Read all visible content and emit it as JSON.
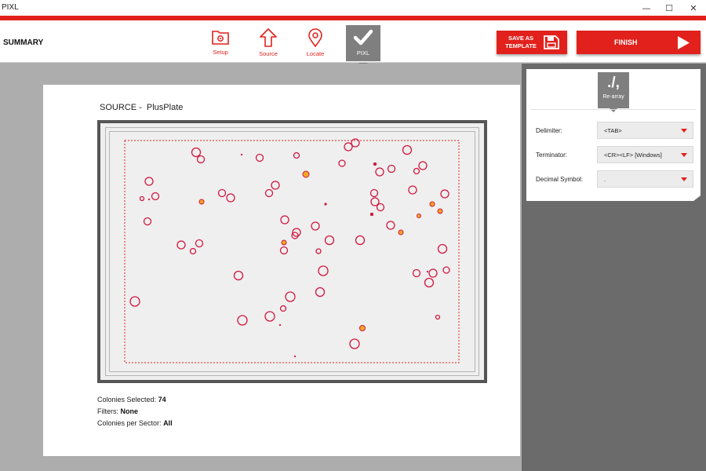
{
  "app": {
    "title": "PIXL",
    "window_controls": {
      "minimize": "—",
      "maximize": "☐",
      "close": "✕"
    }
  },
  "header": {
    "summary_label": "SUMMARY",
    "steps": [
      {
        "label": "Setup",
        "icon": "gear-folder-icon"
      },
      {
        "label": "Source",
        "icon": "arrow-up-icon"
      },
      {
        "label": "Locate",
        "icon": "location-pin-icon"
      },
      {
        "label": "PIXL",
        "icon": "checkmark-icon",
        "active": true
      }
    ],
    "save_template": {
      "line1": "SAVE AS",
      "line2": "TEMPLATE",
      "icon": "floppy-disk-icon"
    },
    "finish": {
      "label": "FINISH",
      "icon": "play-triangle-icon"
    }
  },
  "main": {
    "source_prefix": "SOURCE -",
    "source_name": "PlusPlate",
    "plate": {
      "colonies": [
        [
          250,
          194,
          5.5
        ],
        [
          256,
          203,
          4.5
        ],
        [
          331,
          201,
          4.5
        ],
        [
          378,
          198,
          3.5
        ],
        [
          444,
          187,
          5
        ],
        [
          453,
          182,
          5
        ],
        [
          519,
          191,
          5.5
        ],
        [
          436,
          208,
          4
        ],
        [
          484,
          219,
          5
        ],
        [
          499,
          215,
          4.5
        ],
        [
          539,
          211,
          5
        ],
        [
          531,
          218,
          3.5
        ],
        [
          190,
          231,
          5
        ],
        [
          198,
          250,
          4.5
        ],
        [
          283,
          246,
          4.5
        ],
        [
          294,
          252,
          5
        ],
        [
          343,
          246,
          4.5
        ],
        [
          351,
          236,
          5
        ],
        [
          477,
          246,
          4.5
        ],
        [
          478,
          257,
          5
        ],
        [
          485,
          264,
          4.5
        ],
        [
          526,
          242,
          5
        ],
        [
          567,
          247,
          5
        ],
        [
          188,
          282,
          4.5
        ],
        [
          363,
          280,
          5
        ],
        [
          402,
          288,
          5
        ],
        [
          498,
          287,
          5
        ],
        [
          378,
          296,
          5
        ],
        [
          376,
          300,
          4
        ],
        [
          231,
          312,
          5
        ],
        [
          254,
          310,
          4.5
        ],
        [
          246,
          320,
          3.5
        ],
        [
          362,
          319,
          4.5
        ],
        [
          420,
          306,
          5.5
        ],
        [
          459,
          306,
          5.5
        ],
        [
          406,
          320,
          3
        ],
        [
          564,
          317,
          5.5
        ],
        [
          304,
          351,
          5.5
        ],
        [
          412,
          345,
          6
        ],
        [
          531,
          348,
          4.5
        ],
        [
          552,
          348,
          5
        ],
        [
          569,
          344,
          4
        ],
        [
          547,
          360,
          5.5
        ],
        [
          172,
          384,
          6
        ],
        [
          370,
          378,
          6
        ],
        [
          408,
          372,
          5.5
        ],
        [
          361,
          393,
          3.5
        ],
        [
          309,
          408,
          6
        ],
        [
          344,
          403,
          6
        ],
        [
          452,
          438,
          6
        ],
        [
          190,
          254,
          0
        ],
        [
          181,
          253,
          2.5
        ],
        [
          308,
          197,
          1
        ],
        [
          415,
          260,
          1.5
        ],
        [
          474,
          273,
          2
        ],
        [
          545,
          346,
          1
        ],
        [
          357,
          414,
          1
        ],
        [
          376,
          454,
          1
        ],
        [
          558,
          404,
          2.5
        ],
        [
          478,
          209,
          2
        ]
      ],
      "highlighted_colonies": [
        [
          390,
          222,
          4
        ],
        [
          257,
          257,
          3
        ],
        [
          551,
          260,
          3
        ],
        [
          561,
          269,
          3
        ],
        [
          534,
          275,
          2.5
        ],
        [
          511,
          296,
          3
        ],
        [
          362,
          309,
          3
        ],
        [
          462,
          418,
          3.5
        ]
      ]
    },
    "info": {
      "colonies_selected_label": "Colonies Selected:",
      "colonies_selected_value": "74",
      "filters_label": "Filters:",
      "filters_value": "None",
      "colonies_per_sector_label": "Colonies per Sector:",
      "colonies_per_sector_value": "All"
    }
  },
  "settings": {
    "tab": {
      "glyph": "./,",
      "label": "Re-array"
    },
    "rows": [
      {
        "label": "Delimiter:",
        "value": "<TAB>"
      },
      {
        "label": "Terminator:",
        "value": "<CR><LF> [Windows]"
      },
      {
        "label": "Decimal Symbol:",
        "value": "."
      }
    ]
  },
  "colors": {
    "accent": "#e2211c",
    "colony_stroke": "#d0173f",
    "colony_fill_highlight": "#f5a623"
  }
}
